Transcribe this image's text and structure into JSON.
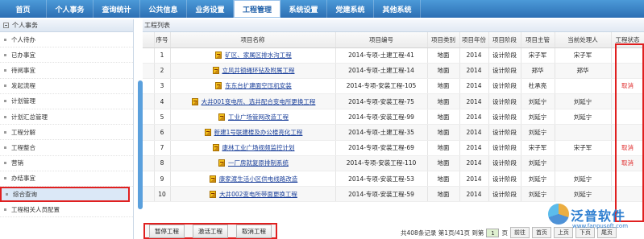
{
  "nav": {
    "items": [
      "首页",
      "个人事务",
      "查询统计",
      "公共信息",
      "业务设置",
      "工程管理",
      "系统设置",
      "党建系统",
      "其他系统"
    ],
    "active_index": 5
  },
  "sidebar": {
    "header": "个人事务",
    "items": [
      "个人待办",
      "已办事宜",
      "待阅事宜",
      "发起流程",
      "计划管理",
      "计划汇总管理",
      "工程分解",
      "工程整合",
      "营销",
      "办结事宜",
      "综合查询",
      "工程相关人员配置"
    ],
    "selected_index": 10
  },
  "panel": {
    "title": "工程列表"
  },
  "table": {
    "headers": [
      "",
      "序号",
      "项目名称",
      "项目编号",
      "项目类别",
      "项目年份",
      "项目阶段",
      "项目主管",
      "当前处理人",
      "工程状态"
    ],
    "rows": [
      {
        "no": "1",
        "name": "矿区、家属区排水沟工程",
        "code": "2014-专项-土建工程-41",
        "category": "地面",
        "year": "2014",
        "stage": "设计阶段",
        "manager": "宋子军",
        "handler": "宋子军",
        "status": ""
      },
      {
        "no": "2",
        "name": "立风井锁绳环钻及附属工程",
        "code": "2014-专项-土建工程-14",
        "category": "地面",
        "year": "2014",
        "stage": "设计阶段",
        "manager": "郑华",
        "handler": "郑华",
        "status": ""
      },
      {
        "no": "3",
        "name": "东东台扩建面空压机安装",
        "code": "2014-专项-安装工程-105",
        "category": "地面",
        "year": "2014",
        "stage": "设计阶段",
        "manager": "杜承亮",
        "handler": "",
        "status": "取消"
      },
      {
        "no": "4",
        "name": "大井001变电所、选井配合变电所更换工程",
        "code": "2014-专项-安装工程-75",
        "category": "地面",
        "year": "2014",
        "stage": "设计阶段",
        "manager": "刘延宁",
        "handler": "刘延宁",
        "status": ""
      },
      {
        "no": "5",
        "name": "工业广场管网改造工程",
        "code": "2014-专项-安装工程-99",
        "category": "地面",
        "year": "2014",
        "stage": "设计阶段",
        "manager": "刘延宁",
        "handler": "刘延宁",
        "status": ""
      },
      {
        "no": "6",
        "name": "新建1号联建楼及办公楼亮化工程",
        "code": "2014-专项-土建工程-35",
        "category": "地面",
        "year": "2014",
        "stage": "设计阶段",
        "manager": "刘延宁",
        "handler": "",
        "status": ""
      },
      {
        "no": "7",
        "name": "康林工业广场视频监控计划",
        "code": "2014-专项-安装工程-69",
        "category": "地面",
        "year": "2014",
        "stage": "设计阶段",
        "manager": "宋子军",
        "handler": "宋子军",
        "status": "取消"
      },
      {
        "no": "8",
        "name": "一厂房就复原排制系统",
        "code": "2014-专项-安装工程-110",
        "category": "地面",
        "year": "2014",
        "stage": "设计阶段",
        "manager": "刘延宁",
        "handler": "",
        "status": "取消"
      },
      {
        "no": "9",
        "name": "康家渡生活小区供电线路改造",
        "code": "2014-专项-安装工程-53",
        "category": "地面",
        "year": "2014",
        "stage": "设计阶段",
        "manager": "刘延宁",
        "handler": "刘延宁",
        "status": ""
      },
      {
        "no": "10",
        "name": "大井002变电所带面更换工程",
        "code": "2014-专项-安装工程-59",
        "category": "地面",
        "year": "2014",
        "stage": "设计阶段",
        "manager": "刘延宁",
        "handler": "刘延宁",
        "status": ""
      }
    ]
  },
  "toolbar": {
    "pause": "暂停工程",
    "activate": "激活工程",
    "cancel": "取消工程"
  },
  "pager": {
    "summary": "共408条记录 第1页/41页 到第",
    "current": "1",
    "suffix": "页",
    "go": "前往",
    "first": "首页",
    "prev": "上页",
    "next": "下页",
    "last": "尾页"
  },
  "watermark": {
    "title": "泛普软件",
    "url": "www.fanpusoft.com"
  },
  "colors": {
    "nav_blue": "#2d6fb4",
    "highlight_red": "#e02020",
    "link_blue": "#1a3f9a",
    "cancel_red": "#e03030"
  }
}
